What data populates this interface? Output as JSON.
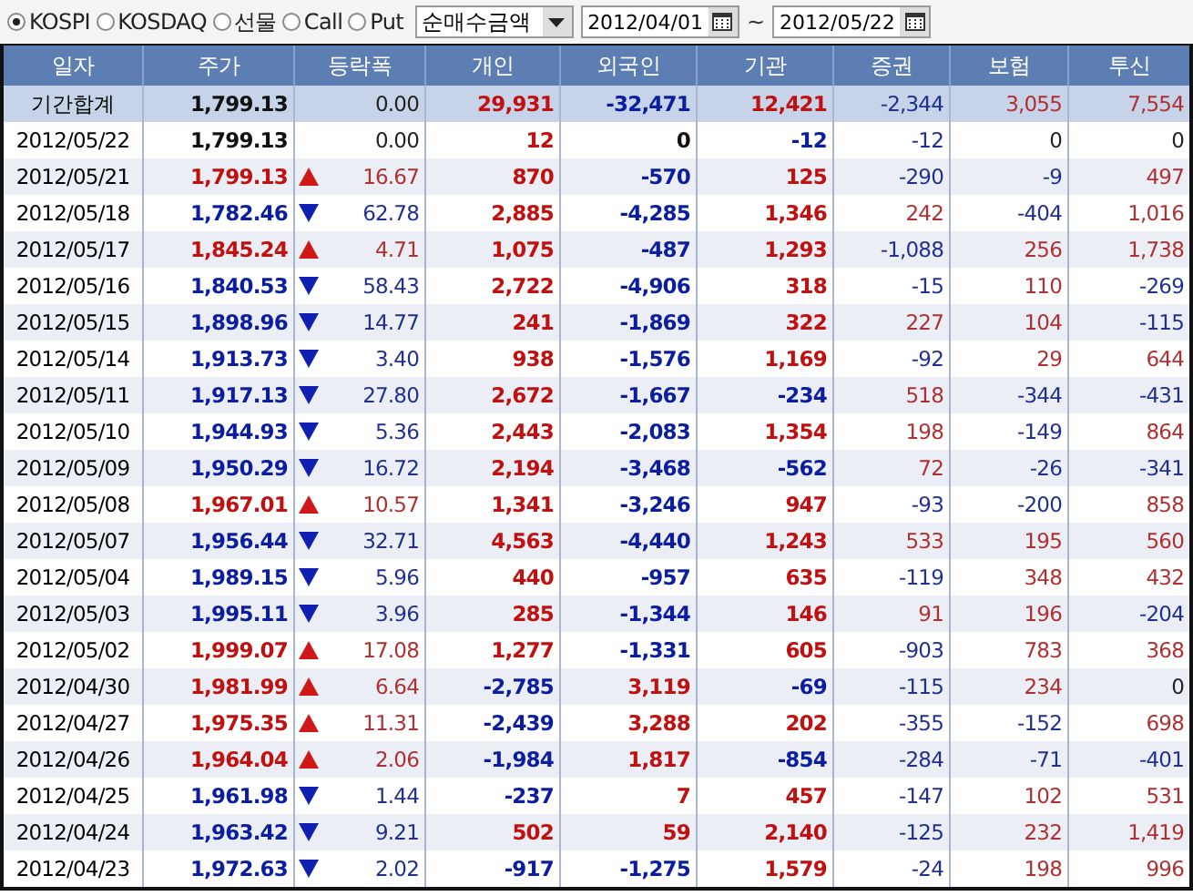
{
  "markets": [
    {
      "label": "KOSPI",
      "selected": true
    },
    {
      "label": "KOSDAQ",
      "selected": false
    },
    {
      "label": "선물",
      "selected": false
    },
    {
      "label": "Call",
      "selected": false
    },
    {
      "label": "Put",
      "selected": false
    }
  ],
  "measure": {
    "value": "순매수금액"
  },
  "period": {
    "from": "2012/04/01",
    "separator": "~",
    "to": "2012/05/22"
  },
  "table": {
    "columns": [
      "일자",
      "주가",
      "등락폭",
      "개인",
      "외국인",
      "기관",
      "증권",
      "보험",
      "투신"
    ],
    "rows": [
      {
        "kind": "summary",
        "date": "기간합계",
        "price": "1,799.13",
        "rising": false,
        "falling": false,
        "change": "0.00",
        "values": [
          "29,931",
          "-32,471",
          "12,421",
          "-2,344",
          "3,055",
          "7,554"
        ]
      },
      {
        "kind": "day",
        "date": "2012/05/22",
        "price": "1,799.13",
        "rising": false,
        "falling": false,
        "change": "0.00",
        "values": [
          "12",
          "0",
          "-12",
          "-12",
          "0",
          "0"
        ]
      },
      {
        "kind": "day",
        "date": "2012/05/21",
        "price": "1,799.13",
        "rising": true,
        "falling": false,
        "change": "16.67",
        "values": [
          "870",
          "-570",
          "125",
          "-290",
          "-9",
          "497"
        ]
      },
      {
        "kind": "day",
        "date": "2012/05/18",
        "price": "1,782.46",
        "rising": false,
        "falling": true,
        "change": "62.78",
        "values": [
          "2,885",
          "-4,285",
          "1,346",
          "242",
          "-404",
          "1,016"
        ]
      },
      {
        "kind": "day",
        "date": "2012/05/17",
        "price": "1,845.24",
        "rising": true,
        "falling": false,
        "change": "4.71",
        "values": [
          "1,075",
          "-487",
          "1,293",
          "-1,088",
          "256",
          "1,738"
        ]
      },
      {
        "kind": "day",
        "date": "2012/05/16",
        "price": "1,840.53",
        "rising": false,
        "falling": true,
        "change": "58.43",
        "values": [
          "2,722",
          "-4,906",
          "318",
          "-15",
          "110",
          "-269"
        ]
      },
      {
        "kind": "day",
        "date": "2012/05/15",
        "price": "1,898.96",
        "rising": false,
        "falling": true,
        "change": "14.77",
        "values": [
          "241",
          "-1,869",
          "322",
          "227",
          "104",
          "-115"
        ]
      },
      {
        "kind": "day",
        "date": "2012/05/14",
        "price": "1,913.73",
        "rising": false,
        "falling": true,
        "change": "3.40",
        "values": [
          "938",
          "-1,576",
          "1,169",
          "-92",
          "29",
          "644"
        ]
      },
      {
        "kind": "day",
        "date": "2012/05/11",
        "price": "1,917.13",
        "rising": false,
        "falling": true,
        "change": "27.80",
        "values": [
          "2,672",
          "-1,667",
          "-234",
          "518",
          "-344",
          "-431"
        ]
      },
      {
        "kind": "day",
        "date": "2012/05/10",
        "price": "1,944.93",
        "rising": false,
        "falling": true,
        "change": "5.36",
        "values": [
          "2,443",
          "-2,083",
          "1,354",
          "198",
          "-149",
          "864"
        ]
      },
      {
        "kind": "day",
        "date": "2012/05/09",
        "price": "1,950.29",
        "rising": false,
        "falling": true,
        "change": "16.72",
        "values": [
          "2,194",
          "-3,468",
          "-562",
          "72",
          "-26",
          "-341"
        ]
      },
      {
        "kind": "day",
        "date": "2012/05/08",
        "price": "1,967.01",
        "rising": true,
        "falling": false,
        "change": "10.57",
        "values": [
          "1,341",
          "-3,246",
          "947",
          "-93",
          "-200",
          "858"
        ]
      },
      {
        "kind": "day",
        "date": "2012/05/07",
        "price": "1,956.44",
        "rising": false,
        "falling": true,
        "change": "32.71",
        "values": [
          "4,563",
          "-4,440",
          "1,243",
          "533",
          "195",
          "560"
        ]
      },
      {
        "kind": "day",
        "date": "2012/05/04",
        "price": "1,989.15",
        "rising": false,
        "falling": true,
        "change": "5.96",
        "values": [
          "440",
          "-957",
          "635",
          "-119",
          "348",
          "432"
        ]
      },
      {
        "kind": "day",
        "date": "2012/05/03",
        "price": "1,995.11",
        "rising": false,
        "falling": true,
        "change": "3.96",
        "values": [
          "285",
          "-1,344",
          "146",
          "91",
          "196",
          "-204"
        ]
      },
      {
        "kind": "day",
        "date": "2012/05/02",
        "price": "1,999.07",
        "rising": true,
        "falling": false,
        "change": "17.08",
        "values": [
          "1,277",
          "-1,331",
          "605",
          "-903",
          "783",
          "368"
        ]
      },
      {
        "kind": "day",
        "date": "2012/04/30",
        "price": "1,981.99",
        "rising": true,
        "falling": false,
        "change": "6.64",
        "values": [
          "-2,785",
          "3,119",
          "-69",
          "-115",
          "234",
          "0"
        ]
      },
      {
        "kind": "day",
        "date": "2012/04/27",
        "price": "1,975.35",
        "rising": true,
        "falling": false,
        "change": "11.31",
        "values": [
          "-2,439",
          "3,288",
          "202",
          "-355",
          "-152",
          "698"
        ]
      },
      {
        "kind": "day",
        "date": "2012/04/26",
        "price": "1,964.04",
        "rising": true,
        "falling": false,
        "change": "2.06",
        "values": [
          "-1,984",
          "1,817",
          "-854",
          "-284",
          "-71",
          "-401"
        ]
      },
      {
        "kind": "day",
        "date": "2012/04/25",
        "price": "1,961.98",
        "rising": false,
        "falling": true,
        "change": "1.44",
        "values": [
          "-237",
          "7",
          "457",
          "-147",
          "102",
          "531"
        ]
      },
      {
        "kind": "day",
        "date": "2012/04/24",
        "price": "1,963.42",
        "rising": false,
        "falling": true,
        "change": "9.21",
        "values": [
          "502",
          "59",
          "2,140",
          "-125",
          "232",
          "1,419"
        ]
      },
      {
        "kind": "day",
        "date": "2012/04/23",
        "price": "1,972.63",
        "rising": false,
        "falling": true,
        "change": "2.02",
        "values": [
          "-917",
          "-1,275",
          "1,579",
          "-24",
          "198",
          "996"
        ]
      }
    ]
  }
}
